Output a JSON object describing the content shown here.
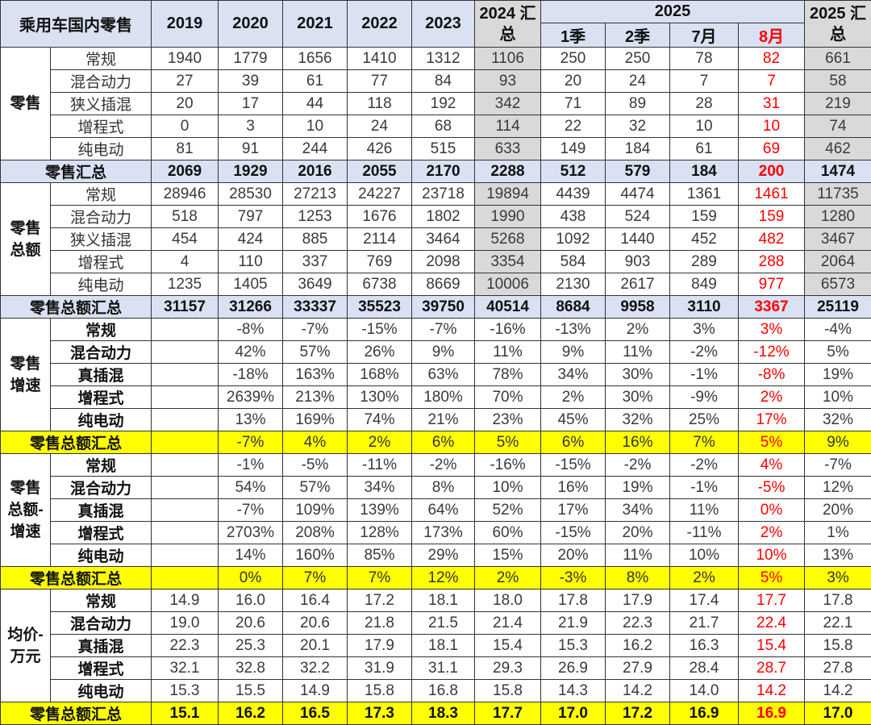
{
  "header": {
    "title": "乘用车国内零售",
    "years": [
      "2019",
      "2020",
      "2021",
      "2022",
      "2023"
    ],
    "total_2024": "2024 汇总",
    "year_2025": "2025",
    "periods_2025": [
      "1季",
      "2季",
      "7月",
      "8月"
    ],
    "total_2025": "2025 汇总"
  },
  "colors": {
    "header_bg": "#d9e1f2",
    "gray_bg": "#d9d9d9",
    "yellow_bg": "#ffff00",
    "highlight_text": "#ff0000"
  },
  "sections": [
    {
      "label": "零售",
      "rows": [
        {
          "label": "常规",
          "values": [
            "1940",
            "1779",
            "1656",
            "1410",
            "1312",
            "1106",
            "250",
            "250",
            "78",
            "82",
            "661"
          ]
        },
        {
          "label": "混合动力",
          "values": [
            "27",
            "39",
            "61",
            "77",
            "84",
            "93",
            "20",
            "24",
            "7",
            "7",
            "58"
          ]
        },
        {
          "label": "狭义插混",
          "values": [
            "20",
            "17",
            "44",
            "118",
            "192",
            "342",
            "71",
            "89",
            "28",
            "31",
            "219"
          ]
        },
        {
          "label": "增程式",
          "values": [
            "0",
            "3",
            "10",
            "24",
            "68",
            "114",
            "22",
            "32",
            "10",
            "10",
            "74"
          ]
        },
        {
          "label": "纯电动",
          "values": [
            "81",
            "91",
            "244",
            "426",
            "515",
            "633",
            "149",
            "184",
            "61",
            "69",
            "462"
          ]
        }
      ],
      "total": {
        "label": "零售汇总",
        "values": [
          "2069",
          "1929",
          "2016",
          "2055",
          "2170",
          "2288",
          "512",
          "579",
          "184",
          "200",
          "1474"
        ]
      }
    },
    {
      "label": "零售总额",
      "rows": [
        {
          "label": "常规",
          "values": [
            "28946",
            "28530",
            "27213",
            "24227",
            "23718",
            "19894",
            "4439",
            "4474",
            "1361",
            "1461",
            "11735"
          ]
        },
        {
          "label": "混合动力",
          "values": [
            "518",
            "797",
            "1253",
            "1676",
            "1802",
            "1990",
            "438",
            "524",
            "159",
            "159",
            "1280"
          ]
        },
        {
          "label": "狭义插混",
          "values": [
            "454",
            "424",
            "885",
            "2114",
            "3464",
            "5268",
            "1092",
            "1440",
            "452",
            "482",
            "3467"
          ]
        },
        {
          "label": "增程式",
          "values": [
            "4",
            "110",
            "337",
            "769",
            "2098",
            "3354",
            "584",
            "903",
            "289",
            "288",
            "2064"
          ]
        },
        {
          "label": "纯电动",
          "values": [
            "1235",
            "1405",
            "3649",
            "6738",
            "8669",
            "10006",
            "2130",
            "2617",
            "849",
            "977",
            "6573"
          ]
        }
      ],
      "total": {
        "label": "零售总额汇总",
        "values": [
          "31157",
          "31266",
          "33337",
          "35523",
          "39750",
          "40514",
          "8684",
          "9958",
          "3110",
          "3367",
          "25119"
        ]
      }
    },
    {
      "label": "零售增速",
      "rows": [
        {
          "label": "常规",
          "values": [
            "",
            "-8%",
            "-7%",
            "-15%",
            "-7%",
            "-16%",
            "-13%",
            "2%",
            "3%",
            "3%",
            "-4%"
          ]
        },
        {
          "label": "混合动力",
          "values": [
            "",
            "42%",
            "57%",
            "26%",
            "9%",
            "11%",
            "9%",
            "11%",
            "-2%",
            "-12%",
            "5%"
          ]
        },
        {
          "label": "真插混",
          "values": [
            "",
            "-18%",
            "163%",
            "168%",
            "63%",
            "78%",
            "34%",
            "30%",
            "-1%",
            "-8%",
            "19%"
          ]
        },
        {
          "label": "增程式",
          "values": [
            "",
            "2639%",
            "213%",
            "130%",
            "180%",
            "70%",
            "2%",
            "30%",
            "-9%",
            "2%",
            "10%"
          ]
        },
        {
          "label": "纯电动",
          "values": [
            "",
            "13%",
            "169%",
            "74%",
            "21%",
            "23%",
            "45%",
            "32%",
            "25%",
            "17%",
            "32%"
          ]
        }
      ],
      "total": {
        "label": "零售总额汇总",
        "values": [
          "",
          "-7%",
          "4%",
          "2%",
          "6%",
          "5%",
          "6%",
          "16%",
          "7%",
          "5%",
          "9%"
        ]
      }
    },
    {
      "label": "零售总额-增速",
      "rows": [
        {
          "label": "常规",
          "values": [
            "",
            "-1%",
            "-5%",
            "-11%",
            "-2%",
            "-16%",
            "-15%",
            "-2%",
            "-2%",
            "4%",
            "-7%"
          ]
        },
        {
          "label": "混合动力",
          "values": [
            "",
            "54%",
            "57%",
            "34%",
            "8%",
            "10%",
            "16%",
            "19%",
            "-1%",
            "-5%",
            "12%"
          ]
        },
        {
          "label": "真插混",
          "values": [
            "",
            "-7%",
            "109%",
            "139%",
            "64%",
            "52%",
            "17%",
            "34%",
            "11%",
            "0%",
            "20%"
          ]
        },
        {
          "label": "增程式",
          "values": [
            "",
            "2703%",
            "208%",
            "128%",
            "173%",
            "60%",
            "-15%",
            "20%",
            "-11%",
            "2%",
            "1%"
          ]
        },
        {
          "label": "纯电动",
          "values": [
            "",
            "14%",
            "160%",
            "85%",
            "29%",
            "15%",
            "20%",
            "11%",
            "10%",
            "10%",
            "13%"
          ]
        }
      ],
      "total": {
        "label": "零售总额汇总",
        "values": [
          "",
          "0%",
          "7%",
          "7%",
          "12%",
          "2%",
          "-3%",
          "8%",
          "2%",
          "5%",
          "3%"
        ]
      }
    },
    {
      "label": "均价-万元",
      "rows": [
        {
          "label": "常规",
          "values": [
            "14.9",
            "16.0",
            "16.4",
            "17.2",
            "18.1",
            "18.0",
            "17.8",
            "17.9",
            "17.4",
            "17.7",
            "17.8"
          ]
        },
        {
          "label": "混合动力",
          "values": [
            "19.0",
            "20.6",
            "20.6",
            "21.8",
            "21.5",
            "21.4",
            "21.9",
            "22.3",
            "21.7",
            "22.4",
            "22.1"
          ]
        },
        {
          "label": "真插混",
          "values": [
            "22.3",
            "25.3",
            "20.1",
            "17.9",
            "18.1",
            "15.4",
            "15.3",
            "16.2",
            "16.3",
            "15.4",
            "15.8"
          ]
        },
        {
          "label": "增程式",
          "values": [
            "32.1",
            "32.8",
            "32.2",
            "31.9",
            "31.1",
            "29.3",
            "26.9",
            "27.9",
            "28.4",
            "28.7",
            "27.8"
          ]
        },
        {
          "label": "纯电动",
          "values": [
            "15.3",
            "15.5",
            "14.9",
            "15.8",
            "16.8",
            "15.8",
            "14.3",
            "14.2",
            "14.0",
            "14.2",
            "14.2"
          ]
        }
      ],
      "total": {
        "label": "零售总额汇总",
        "values": [
          "15.1",
          "16.2",
          "16.5",
          "17.3",
          "18.3",
          "17.7",
          "17.0",
          "17.2",
          "16.9",
          "16.9",
          "17.0"
        ]
      }
    }
  ]
}
